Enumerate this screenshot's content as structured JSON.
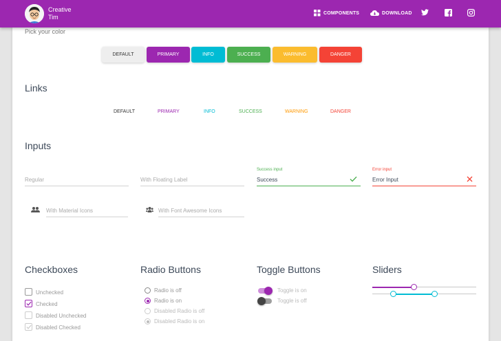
{
  "navbar": {
    "brand_line1": "Creative",
    "brand_line2": "Tim",
    "items": [
      {
        "label": "COMPONENTS",
        "icon": "grid-icon"
      },
      {
        "label": "DOWNLOAD",
        "icon": "cloud-download-icon"
      }
    ],
    "social": [
      "twitter-icon",
      "facebook-icon",
      "instagram-icon"
    ]
  },
  "colors": {
    "default": "#eeeeee",
    "primary": "#9c27b0",
    "info": "#00bcd4",
    "success": "#4caf50",
    "warning": "#ff9800",
    "danger": "#f44336"
  },
  "buttons": {
    "pick_label": "Pick your color",
    "items": [
      "DEFAULT",
      "PRIMARY",
      "INFO",
      "SUCCESS",
      "WARNING",
      "DANGER"
    ]
  },
  "links": {
    "title": "Links",
    "items": [
      "DEFAULT",
      "PRIMARY",
      "INFO",
      "SUCCESS",
      "WARNING",
      "DANGER"
    ]
  },
  "inputs": {
    "title": "Inputs",
    "regular_placeholder": "Regular",
    "floating_placeholder": "With Floating Label",
    "success_label": "Success input",
    "success_value": "Success",
    "error_label": "Error input",
    "error_value": "Error Input",
    "material_icons_placeholder": "With Material Icons",
    "font_awesome_placeholder": "With Font Awesome Icons"
  },
  "checkboxes": {
    "title": "Checkboxes",
    "items": [
      {
        "label": "Unchecked",
        "checked": false,
        "disabled": false
      },
      {
        "label": "Checked",
        "checked": true,
        "disabled": false
      },
      {
        "label": "Disabled Unchecked",
        "checked": false,
        "disabled": true
      },
      {
        "label": "Disabled Checked",
        "checked": true,
        "disabled": true
      }
    ]
  },
  "radios": {
    "title": "Radio Buttons",
    "items": [
      {
        "label": "Radio is off",
        "selected": false,
        "disabled": false
      },
      {
        "label": "Radio is on",
        "selected": true,
        "disabled": false
      },
      {
        "label": "Disabled Radio is off",
        "selected": false,
        "disabled": true
      },
      {
        "label": "Disabled Radio is on",
        "selected": true,
        "disabled": true
      }
    ]
  },
  "toggles": {
    "title": "Toggle Buttons",
    "items": [
      {
        "label": "Toggle is on",
        "on": true
      },
      {
        "label": "Toggle is off",
        "on": false
      }
    ]
  },
  "sliders": {
    "title": "Sliders",
    "single_value": 0.4,
    "range_low": 0.2,
    "range_high": 0.6
  }
}
